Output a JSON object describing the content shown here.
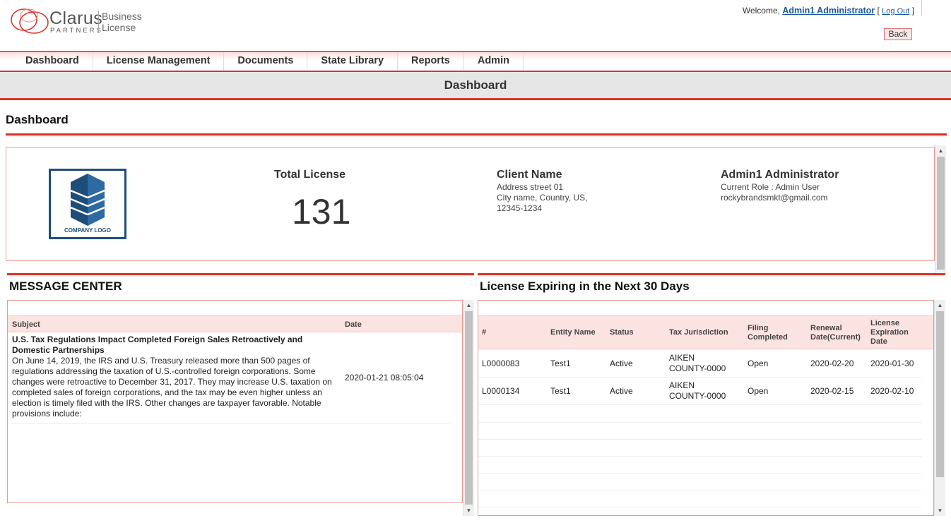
{
  "brand": {
    "name": "Clarus",
    "sub": "PARTNERS",
    "product_line1": "Business",
    "product_line2": "License"
  },
  "header": {
    "welcome": "Welcome,",
    "user": "Admin1 Administrator",
    "bracket_open": "[",
    "logout": "Log Out",
    "bracket_close": "]",
    "back": "Back"
  },
  "nav": {
    "items": [
      {
        "label": "Dashboard"
      },
      {
        "label": "License Management"
      },
      {
        "label": "Documents"
      },
      {
        "label": "State Library"
      },
      {
        "label": "Reports"
      },
      {
        "label": "Admin"
      }
    ]
  },
  "titlebar": "Dashboard",
  "page_heading": "Dashboard",
  "summary": {
    "company_logo_text": "COMPANY LOGO",
    "total_label": "Total License",
    "total_value": "131",
    "client_name": "Client Name",
    "client_address": [
      "Address street 01",
      "City name, Country, US,",
      "12345-1234"
    ],
    "admin_name": "Admin1 Administrator",
    "admin_role": "Current Role : Admin User",
    "admin_email": "rockybrandsmkt@gmail.com"
  },
  "message_center": {
    "title": "MESSAGE CENTER",
    "columns": {
      "subject": "Subject",
      "date": "Date"
    },
    "messages": [
      {
        "subject_title": "U.S. Tax Regulations Impact Completed Foreign Sales Retroactively and Domestic Partnerships",
        "body": "On June 14, 2019, the IRS and U.S. Treasury released more than 500 pages of regulations addressing the taxation of U.S.-controlled foreign corporations. Some changes were retroactive to December 31, 2017. They may increase U.S. taxation on completed sales of foreign corporations, and the tax may be even higher unless an election is timely filed with the IRS. Other changes are taxpayer favorable. Notable provisions include:",
        "date": "2020-01-21 08:05:04"
      }
    ]
  },
  "expiring": {
    "title": "License Expiring in the Next 30 Days",
    "columns": {
      "num": "#",
      "entity": "Entity Name",
      "status": "Status",
      "jurisdiction": "Tax Jurisdiction",
      "filing": "Filing Completed",
      "renewal": "Renewal Date(Current)",
      "expiration": "License Expiration Date"
    },
    "rows": [
      {
        "num": "L0000083",
        "entity": "Test1",
        "status": "Active",
        "jurisdiction": "AIKEN COUNTY-0000",
        "filing": "Open",
        "renewal": "2020-02-20",
        "expiration": "2020-01-30"
      },
      {
        "num": "L0000134",
        "entity": "Test1",
        "status": "Active",
        "jurisdiction": "AIKEN COUNTY-0000",
        "filing": "Open",
        "renewal": "2020-02-15",
        "expiration": "2020-02-10"
      }
    ]
  },
  "colors": {
    "accent": "#d9352a",
    "link": "#1a5a9e",
    "logo_blue": "#1e4d7a"
  }
}
